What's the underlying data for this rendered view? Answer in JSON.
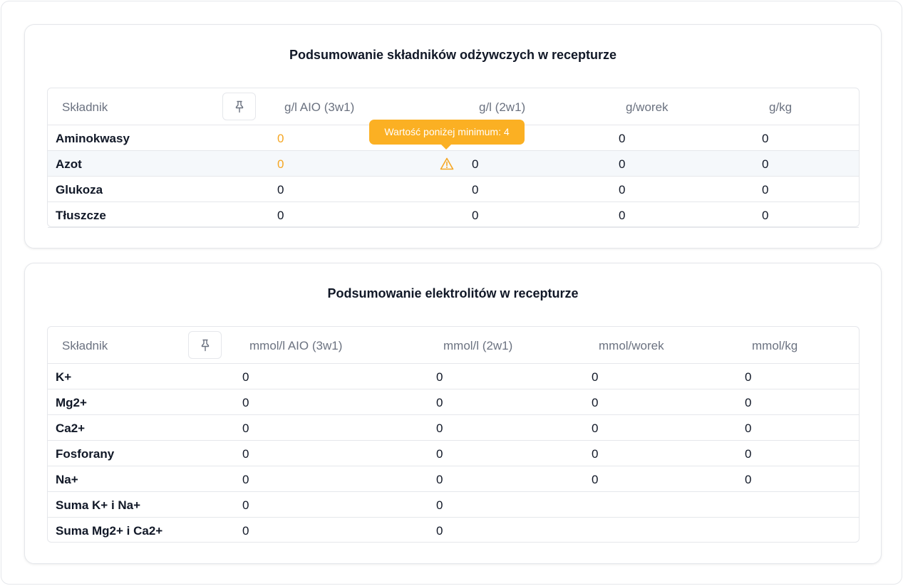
{
  "nutrients": {
    "title": "Podsumowanie składników odżywczych w recepturze",
    "headers": [
      "Składnik",
      "g/l AIO (3w1)",
      "g/l (2w1)",
      "g/worek",
      "g/kg"
    ],
    "pin_icon": "pin-icon",
    "rows": [
      {
        "name": "Aminokwasy",
        "v1": "0",
        "v2": "",
        "v3": "0",
        "v4": "0",
        "v1_warn": true
      },
      {
        "name": "Azot",
        "v1": "0",
        "v2": "0",
        "v3": "0",
        "v4": "0",
        "v1_warn": true,
        "warn_icon": "warning-triangle-icon"
      },
      {
        "name": "Glukoza",
        "v1": "0",
        "v2": "0",
        "v3": "0",
        "v4": "0"
      },
      {
        "name": "Tłuszcze",
        "v1": "0",
        "v2": "0",
        "v3": "0",
        "v4": "0"
      }
    ],
    "tooltip": "Wartość poniżej minimum: 4"
  },
  "electrolytes": {
    "title": "Podsumowanie elektrolitów w recepturze",
    "headers": [
      "Składnik",
      "mmol/l AIO (3w1)",
      "mmol/l (2w1)",
      "mmol/worek",
      "mmol/kg"
    ],
    "pin_icon": "pin-icon",
    "rows": [
      {
        "name": "K+",
        "v1": "0",
        "v2": "0",
        "v3": "0",
        "v4": "0"
      },
      {
        "name": "Mg2+",
        "v1": "0",
        "v2": "0",
        "v3": "0",
        "v4": "0"
      },
      {
        "name": "Ca2+",
        "v1": "0",
        "v2": "0",
        "v3": "0",
        "v4": "0"
      },
      {
        "name": "Fosforany",
        "v1": "0",
        "v2": "0",
        "v3": "0",
        "v4": "0"
      },
      {
        "name": "Na+",
        "v1": "0",
        "v2": "0",
        "v3": "0",
        "v4": "0"
      },
      {
        "name": "Suma K+ i Na+",
        "v1": "0",
        "v2": "0",
        "v3": "",
        "v4": ""
      },
      {
        "name": "Suma Mg2+ i Ca2+",
        "v1": "0",
        "v2": "0",
        "v3": "",
        "v4": ""
      }
    ]
  },
  "colors": {
    "warning": "#f5a623",
    "tooltip_bg": "#fbb023"
  }
}
